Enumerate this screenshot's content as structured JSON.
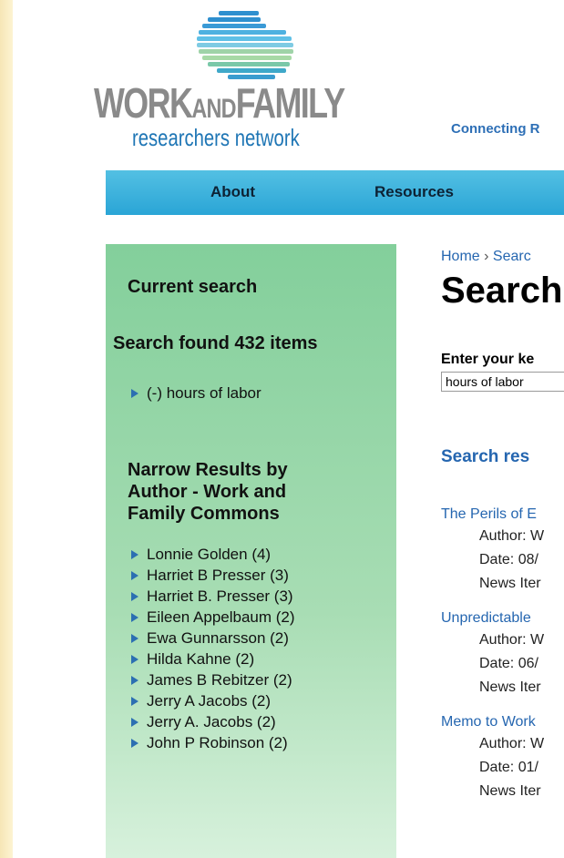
{
  "logo": {
    "word_work": "WORK",
    "word_and": "AND",
    "word_family": "FAMILY",
    "subtitle": "researchers network",
    "colors": [
      "#2e8fcf",
      "#5fc0e6",
      "#9fd3a8",
      "#7ac8a8"
    ]
  },
  "tagline": "Connecting R",
  "nav": {
    "items": [
      {
        "label": "About"
      },
      {
        "label": "Resources"
      }
    ]
  },
  "sidebar": {
    "current_search_heading": "Current search",
    "found_text": "Search found 432 items",
    "active_filter": "(-) hours of labor",
    "narrow_heading_lines": [
      "Narrow Results by",
      "Author - Work and",
      "Family Commons"
    ],
    "authors": [
      "Lonnie Golden (4)",
      "Harriet B Presser (3)",
      "Harriet B. Presser (3)",
      "Eileen Appelbaum (2)",
      "Ewa Gunnarsson (2)",
      "Hilda Kahne (2)",
      "James B Rebitzer (2)",
      "Jerry A Jacobs (2)",
      "Jerry A. Jacobs (2)",
      "John P Robinson (2)"
    ]
  },
  "main": {
    "breadcrumb_home": "Home",
    "breadcrumb_sep": "›",
    "breadcrumb_current": "Searc",
    "title": "Search",
    "keyword_label": "Enter your ke",
    "keyword_value": "hours of labor",
    "results_heading": "Search res",
    "results": [
      {
        "title": "The Perils of E",
        "author": "Author: W",
        "date": "Date: 08/",
        "type": "News Iter"
      },
      {
        "title": "Unpredictable",
        "author": "Author: W",
        "date": "Date: 06/",
        "type": "News Iter"
      },
      {
        "title": "Memo to Work",
        "author": "Author: W",
        "date": "Date: 01/",
        "type": "News Iter"
      }
    ]
  }
}
